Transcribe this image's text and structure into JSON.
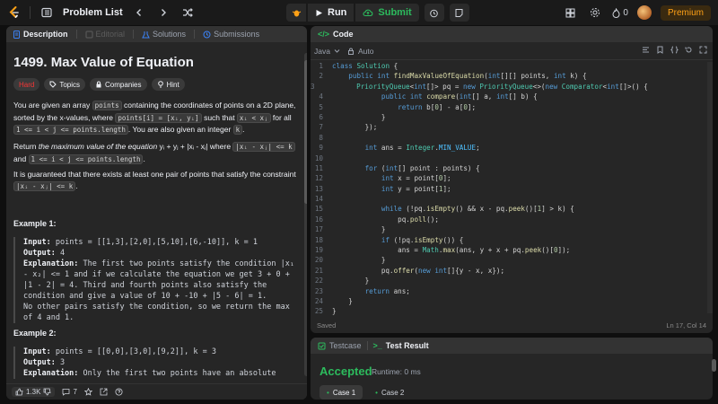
{
  "nav": {
    "problem_list": "Problem List",
    "run": "Run",
    "submit": "Submit",
    "fire_count": "0",
    "premium": "Premium"
  },
  "tabs": {
    "description": "Description",
    "editorial": "Editorial",
    "solutions": "Solutions",
    "submissions": "Submissions"
  },
  "problem": {
    "title": "1499. Max Value of Equation",
    "difficulty": "Hard",
    "tags": [
      "Topics",
      "Companies",
      "Hint"
    ],
    "p1": {
      "a": "You are given an array ",
      "code1": "points",
      "b": " containing the coordinates of points on a 2D plane, sorted by the x-values, where ",
      "code2": "points[i] = [xᵢ, yᵢ]",
      "c": " such that ",
      "code3": "xᵢ < xⱼ",
      "d": " for all ",
      "code4": "1 <= i < j <= points.length",
      "e": ". You are also given an integer ",
      "code5": "k",
      "f": "."
    },
    "p2": {
      "a": "Return ",
      "em": "the maximum value of the equation",
      "b": " yᵢ + yⱼ + |xᵢ - xⱼ| where ",
      "code1": "|xᵢ - xⱼ| <= k",
      "c": " and ",
      "code2": "1 <= i < j <= points.length",
      "d": "."
    },
    "p3": {
      "a": "It is guaranteed that there exists at least one pair of points that satisfy the constraint ",
      "code1": "|xᵢ - xⱼ| <= k",
      "b": "."
    },
    "example1": {
      "title": "Example 1:",
      "input_label": "Input:",
      "input": " points = [[1,3],[2,0],[5,10],[6,-10]], k = 1",
      "output_label": "Output:",
      "output": " 4",
      "expl_label": "Explanation:",
      "expl": " The first two points satisfy the condition |x₁ - x₂| <= 1 and if we calculate the equation we get 3 + 0 + |1 - 2| = 4. Third and fourth points also satisfy the condition and give a value of 10 + -10 + |5 - 6| = 1.",
      "expl2": "No other pairs satisfy the condition, so we return the max of 4 and 1."
    },
    "example2": {
      "title": "Example 2:",
      "input_label": "Input:",
      "input": " points = [[0,0],[3,0],[9,2]], k = 3",
      "output_label": "Output:",
      "output": " 3",
      "expl_label": "Explanation:",
      "expl": " Only the first two points have an absolute"
    }
  },
  "bottom": {
    "likes": "1.3K",
    "comments": "7"
  },
  "code": {
    "header": "Code",
    "language": "Java",
    "auto": "Auto",
    "saved": "Saved",
    "cursor": "Ln 17, Col 14"
  },
  "test": {
    "testcase_tab": "Testcase",
    "result_tab": "Test Result",
    "status": "Accepted",
    "runtime": "Runtime: 0 ms",
    "cases": [
      "Case 1",
      "Case 2"
    ]
  },
  "colors": {
    "accent": "#ffa116",
    "accepted": "#2cbb5d",
    "hard": "#f63636"
  }
}
